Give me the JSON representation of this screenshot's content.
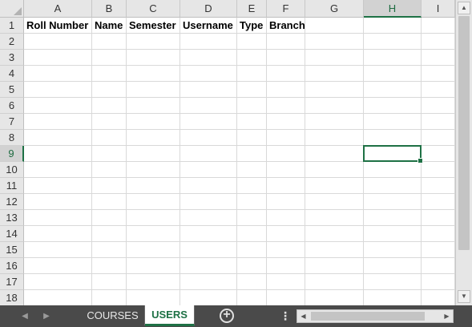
{
  "columns": [
    "A",
    "B",
    "C",
    "D",
    "E",
    "F",
    "G",
    "H",
    "I"
  ],
  "active_column": "H",
  "rows": [
    "1",
    "2",
    "3",
    "4",
    "5",
    "6",
    "7",
    "8",
    "9",
    "10",
    "11",
    "12",
    "13",
    "14",
    "15",
    "16",
    "17",
    "18"
  ],
  "active_row": "9",
  "header_cells": [
    "Roll Number",
    "Name",
    "Semester",
    "Username",
    "Type",
    "Branch"
  ],
  "sheet_tabs": [
    {
      "label": "COURSES",
      "active": false
    },
    {
      "label": "USERS",
      "active": true
    }
  ],
  "accent_color": "#1e7145",
  "icons": {
    "tab_prev": "triangle-left-icon",
    "tab_next": "triangle-right-icon",
    "add_sheet": "plus-circle-icon",
    "more": "vertical-ellipsis-icon",
    "scroll_up": "arrow-up-icon",
    "scroll_down": "arrow-down-icon",
    "scroll_left": "arrow-left-icon",
    "scroll_right": "arrow-right-icon"
  }
}
